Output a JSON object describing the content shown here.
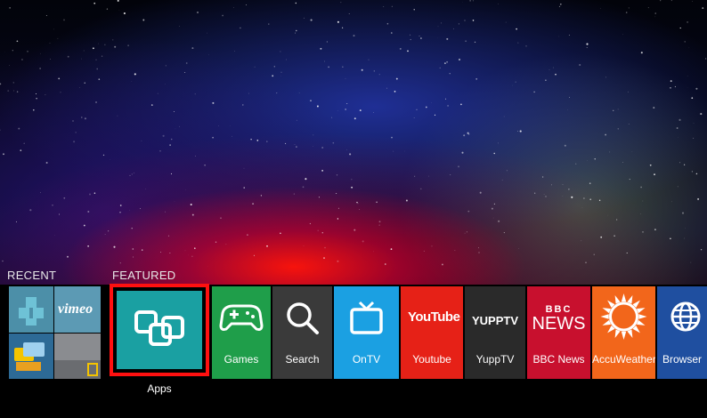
{
  "sections": {
    "recent_label": "RECENT",
    "featured_label": "FEATURED"
  },
  "recent": {
    "vimeo_label": "vimeo"
  },
  "featured": {
    "selected": {
      "label": "Apps",
      "icon": "apps-icon",
      "color": "#1aa0a2",
      "highlight_color": "#ff1010"
    },
    "tiles": [
      {
        "label": "Games",
        "icon": "gamepad-icon",
        "color": "#1f9e4a"
      },
      {
        "label": "Search",
        "icon": "search-icon",
        "color": "#3a3a3a"
      },
      {
        "label": "OnTV",
        "icon": "tv-icon",
        "color": "#1ba0e2"
      },
      {
        "label": "Youtube",
        "icon": "youtube-icon",
        "color": "#e62117"
      },
      {
        "label": "YuppTV",
        "icon": "yupptv-icon",
        "color": "#2a2a2a"
      },
      {
        "label": "BBC News",
        "icon": "bbc-news-icon",
        "color": "#c8102e"
      },
      {
        "label": "AccuWeather",
        "icon": "sun-icon",
        "color": "#f2661b"
      },
      {
        "label": "Browser",
        "icon": "globe-icon",
        "color": "#1f4fa0"
      }
    ]
  },
  "logos": {
    "youtube_text": "YouTube",
    "yupptv_text": "YUPPTV",
    "bbc_text": "BBC",
    "news_text": "NEWS"
  }
}
